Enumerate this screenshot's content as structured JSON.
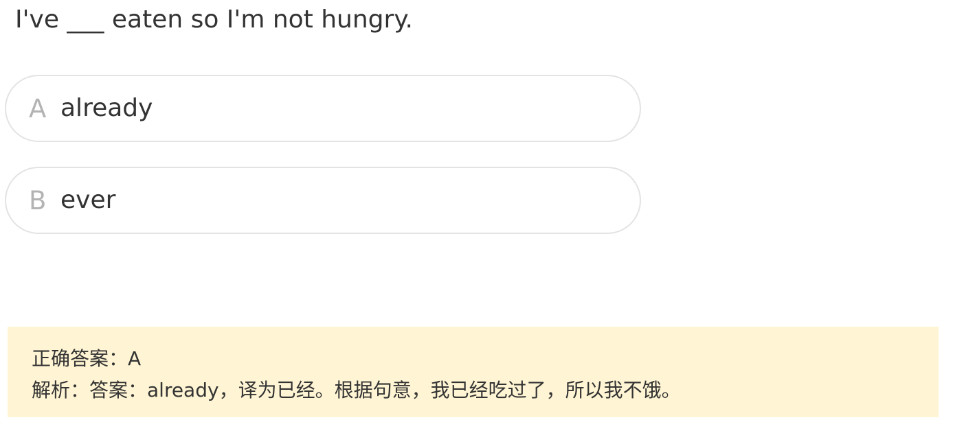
{
  "question": {
    "text": "I've ___ eaten so I'm not hungry."
  },
  "options": [
    {
      "letter": "A",
      "text": "already"
    },
    {
      "letter": "B",
      "text": "ever"
    }
  ],
  "answer": {
    "correct_line": "正确答案：A",
    "explanation_line": "解析：答案：already，译为已经。根据句意，我已经吃过了，所以我不饿。"
  },
  "colors": {
    "option_border": "#e3e3e3",
    "option_letter": "#b3b3b3",
    "answer_background": "#fff5d4",
    "text": "#333333"
  }
}
